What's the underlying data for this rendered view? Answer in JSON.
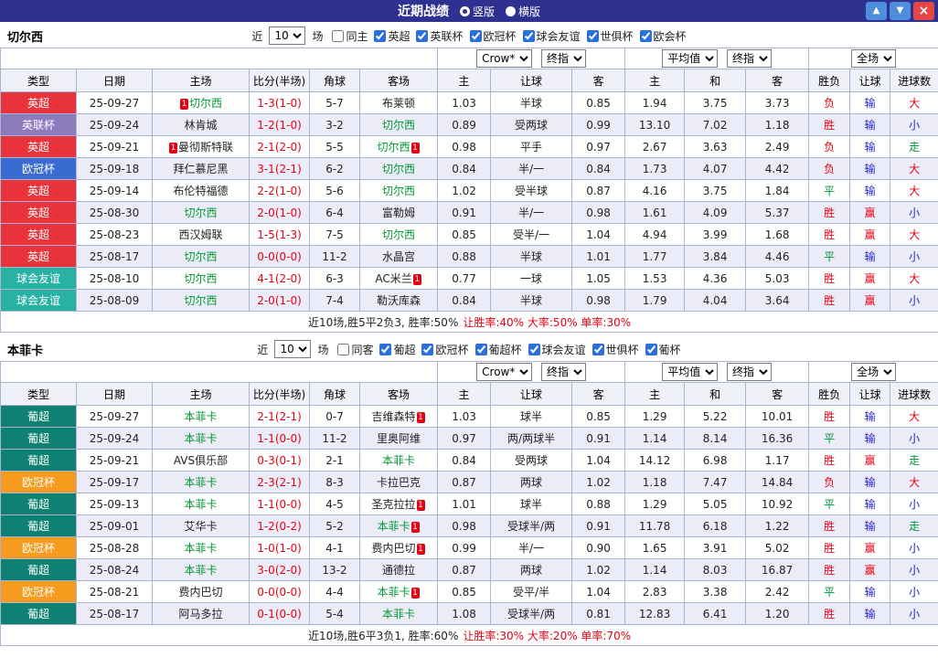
{
  "header": {
    "title": "近期战绩",
    "radios": [
      {
        "label": "竖版",
        "checked": true
      },
      {
        "label": "横版",
        "checked": false
      }
    ],
    "buttons": {
      "up": "▲",
      "down": "▼",
      "close": "×"
    },
    "bar_color": "#2f3190",
    "btn_blue": "#4e8edd",
    "btn_red": "#e64545"
  },
  "palette": {
    "red": "#e60012",
    "blue": "#2525cd",
    "green": "#00943e",
    "focus_green": "#009933"
  },
  "columns": [
    "类型",
    "日期",
    "主场",
    "比分(半场)",
    "角球",
    "客场",
    "主",
    "让球",
    "客",
    "主",
    "和",
    "客",
    "胜负",
    "让球",
    "进球数"
  ],
  "selects_row": {
    "book": "Crow*",
    "final1": "终指",
    "avg": "平均值",
    "final2": "终指",
    "scope": "全场"
  },
  "sections": [
    {
      "team": "切尔西",
      "filter": {
        "prefix": "近",
        "count": "10",
        "suffix": "场",
        "checks": [
          {
            "label": "同主",
            "checked": false
          },
          {
            "label": "英超",
            "checked": true
          },
          {
            "label": "英联杯",
            "checked": true
          },
          {
            "label": "欧冠杯",
            "checked": true
          },
          {
            "label": "球会友谊",
            "checked": true
          },
          {
            "label": "世俱杯",
            "checked": true
          },
          {
            "label": "欧会杯",
            "checked": true
          }
        ]
      },
      "rows": [
        {
          "league": "英超",
          "league_color": "#e8333a",
          "date": "25-09-27",
          "home": {
            "name": "切尔西",
            "focus": true,
            "card_before": "1"
          },
          "score": "1-3(1-0)",
          "corner": "5-7",
          "away": {
            "name": "布莱顿"
          },
          "odds": [
            "1.03",
            "半球",
            "0.85"
          ],
          "euro": [
            "1.94",
            "3.75",
            "3.73"
          ],
          "result": [
            {
              "text": "负",
              "color": "red"
            },
            {
              "text": "输",
              "color": "blue"
            },
            {
              "text": "大",
              "color": "red"
            }
          ]
        },
        {
          "league": "英联杯",
          "league_color": "#8b7cbe",
          "date": "25-09-24",
          "home": {
            "name": "林肯城"
          },
          "score": "1-2(1-0)",
          "corner": "3-2",
          "away": {
            "name": "切尔西",
            "focus": true
          },
          "odds": [
            "0.89",
            "受两球",
            "0.99"
          ],
          "euro": [
            "13.10",
            "7.02",
            "1.18"
          ],
          "result": [
            {
              "text": "胜",
              "color": "red"
            },
            {
              "text": "输",
              "color": "blue"
            },
            {
              "text": "小",
              "color": "blue"
            }
          ]
        },
        {
          "league": "英超",
          "league_color": "#e8333a",
          "date": "25-09-21",
          "home": {
            "name": "曼彻斯特联",
            "card_before": "1"
          },
          "score": "2-1(2-0)",
          "corner": "5-5",
          "away": {
            "name": "切尔西",
            "focus": true,
            "card_after": "1"
          },
          "odds": [
            "0.98",
            "平手",
            "0.97"
          ],
          "euro": [
            "2.67",
            "3.63",
            "2.49"
          ],
          "result": [
            {
              "text": "负",
              "color": "red"
            },
            {
              "text": "输",
              "color": "blue"
            },
            {
              "text": "走",
              "color": "green"
            }
          ]
        },
        {
          "league": "欧冠杯",
          "league_color": "#3a6bd0",
          "date": "25-09-18",
          "home": {
            "name": "拜仁慕尼黑"
          },
          "score": "3-1(2-1)",
          "corner": "6-2",
          "away": {
            "name": "切尔西",
            "focus": true
          },
          "odds": [
            "0.84",
            "半/一",
            "0.84"
          ],
          "euro": [
            "1.73",
            "4.07",
            "4.42"
          ],
          "result": [
            {
              "text": "负",
              "color": "red"
            },
            {
              "text": "输",
              "color": "blue"
            },
            {
              "text": "大",
              "color": "red"
            }
          ]
        },
        {
          "league": "英超",
          "league_color": "#e8333a",
          "date": "25-09-14",
          "home": {
            "name": "布伦特福德"
          },
          "score": "2-2(1-0)",
          "corner": "5-6",
          "away": {
            "name": "切尔西",
            "focus": true
          },
          "odds": [
            "1.02",
            "受半球",
            "0.87"
          ],
          "euro": [
            "4.16",
            "3.75",
            "1.84"
          ],
          "result": [
            {
              "text": "平",
              "color": "green"
            },
            {
              "text": "输",
              "color": "blue"
            },
            {
              "text": "大",
              "color": "red"
            }
          ]
        },
        {
          "league": "英超",
          "league_color": "#e8333a",
          "date": "25-08-30",
          "home": {
            "name": "切尔西",
            "focus": true
          },
          "score": "2-0(1-0)",
          "corner": "6-4",
          "away": {
            "name": "富勒姆"
          },
          "odds": [
            "0.91",
            "半/一",
            "0.98"
          ],
          "euro": [
            "1.61",
            "4.09",
            "5.37"
          ],
          "result": [
            {
              "text": "胜",
              "color": "red"
            },
            {
              "text": "赢",
              "color": "red"
            },
            {
              "text": "小",
              "color": "blue"
            }
          ]
        },
        {
          "league": "英超",
          "league_color": "#e8333a",
          "date": "25-08-23",
          "home": {
            "name": "西汉姆联"
          },
          "score": "1-5(1-3)",
          "corner": "7-5",
          "away": {
            "name": "切尔西",
            "focus": true
          },
          "odds": [
            "0.85",
            "受半/一",
            "1.04"
          ],
          "euro": [
            "4.94",
            "3.99",
            "1.68"
          ],
          "result": [
            {
              "text": "胜",
              "color": "red"
            },
            {
              "text": "赢",
              "color": "red"
            },
            {
              "text": "大",
              "color": "red"
            }
          ]
        },
        {
          "league": "英超",
          "league_color": "#e8333a",
          "date": "25-08-17",
          "home": {
            "name": "切尔西",
            "focus": true
          },
          "score": "0-0(0-0)",
          "corner": "11-2",
          "away": {
            "name": "水晶宫"
          },
          "odds": [
            "0.88",
            "半球",
            "1.01"
          ],
          "euro": [
            "1.77",
            "3.84",
            "4.46"
          ],
          "result": [
            {
              "text": "平",
              "color": "green"
            },
            {
              "text": "输",
              "color": "blue"
            },
            {
              "text": "小",
              "color": "blue"
            }
          ]
        },
        {
          "league": "球会友谊",
          "league_color": "#28b2a2",
          "date": "25-08-10",
          "home": {
            "name": "切尔西",
            "focus": true
          },
          "score": "4-1(2-0)",
          "corner": "6-3",
          "away": {
            "name": "AC米兰",
            "card_after": "1"
          },
          "odds": [
            "0.77",
            "一球",
            "1.05"
          ],
          "euro": [
            "1.53",
            "4.36",
            "5.03"
          ],
          "result": [
            {
              "text": "胜",
              "color": "red"
            },
            {
              "text": "赢",
              "color": "red"
            },
            {
              "text": "大",
              "color": "red"
            }
          ]
        },
        {
          "league": "球会友谊",
          "league_color": "#28b2a2",
          "date": "25-08-09",
          "home": {
            "name": "切尔西",
            "focus": true
          },
          "score": "2-0(1-0)",
          "corner": "7-4",
          "away": {
            "name": "勒沃库森"
          },
          "odds": [
            "0.84",
            "半球",
            "0.98"
          ],
          "euro": [
            "1.79",
            "4.04",
            "3.64"
          ],
          "result": [
            {
              "text": "胜",
              "color": "red"
            },
            {
              "text": "赢",
              "color": "red"
            },
            {
              "text": "小",
              "color": "blue"
            }
          ]
        }
      ],
      "summary": {
        "left": "近10场,胜5平2负3, 胜率:50%",
        "right": "让胜率:40% 大率:50% 单率:30%"
      }
    },
    {
      "team": "本菲卡",
      "filter": {
        "prefix": "近",
        "count": "10",
        "suffix": "场",
        "checks": [
          {
            "label": "同客",
            "checked": false
          },
          {
            "label": "葡超",
            "checked": true
          },
          {
            "label": "欧冠杯",
            "checked": true
          },
          {
            "label": "葡超杯",
            "checked": true
          },
          {
            "label": "球会友谊",
            "checked": true
          },
          {
            "label": "世俱杯",
            "checked": true
          },
          {
            "label": "葡杯",
            "checked": true
          }
        ]
      },
      "rows": [
        {
          "league": "葡超",
          "league_color": "#0e8174",
          "date": "25-09-27",
          "home": {
            "name": "本菲卡",
            "focus": true
          },
          "score": "2-1(2-1)",
          "corner": "0-7",
          "away": {
            "name": "吉维森特",
            "card_after": "1"
          },
          "odds": [
            "1.03",
            "球半",
            "0.85"
          ],
          "euro": [
            "1.29",
            "5.22",
            "10.01"
          ],
          "result": [
            {
              "text": "胜",
              "color": "red"
            },
            {
              "text": "输",
              "color": "blue"
            },
            {
              "text": "大",
              "color": "red"
            }
          ]
        },
        {
          "league": "葡超",
          "league_color": "#0e8174",
          "date": "25-09-24",
          "home": {
            "name": "本菲卡",
            "focus": true
          },
          "score": "1-1(0-0)",
          "corner": "11-2",
          "away": {
            "name": "里奥阿维"
          },
          "odds": [
            "0.97",
            "两/两球半",
            "0.91"
          ],
          "euro": [
            "1.14",
            "8.14",
            "16.36"
          ],
          "result": [
            {
              "text": "平",
              "color": "green"
            },
            {
              "text": "输",
              "color": "blue"
            },
            {
              "text": "小",
              "color": "blue"
            }
          ]
        },
        {
          "league": "葡超",
          "league_color": "#0e8174",
          "date": "25-09-21",
          "home": {
            "name": "AVS俱乐部"
          },
          "score": "0-3(0-1)",
          "corner": "2-1",
          "away": {
            "name": "本菲卡",
            "focus": true
          },
          "odds": [
            "0.84",
            "受两球",
            "1.04"
          ],
          "euro": [
            "14.12",
            "6.98",
            "1.17"
          ],
          "result": [
            {
              "text": "胜",
              "color": "red"
            },
            {
              "text": "赢",
              "color": "red"
            },
            {
              "text": "走",
              "color": "green"
            }
          ]
        },
        {
          "league": "欧冠杯",
          "league_color": "#f79b1e",
          "date": "25-09-17",
          "home": {
            "name": "本菲卡",
            "focus": true
          },
          "score": "2-3(2-1)",
          "corner": "8-3",
          "away": {
            "name": "卡拉巴克"
          },
          "odds": [
            "0.87",
            "两球",
            "1.02"
          ],
          "euro": [
            "1.18",
            "7.47",
            "14.84"
          ],
          "result": [
            {
              "text": "负",
              "color": "red"
            },
            {
              "text": "输",
              "color": "blue"
            },
            {
              "text": "大",
              "color": "red"
            }
          ]
        },
        {
          "league": "葡超",
          "league_color": "#0e8174",
          "date": "25-09-13",
          "home": {
            "name": "本菲卡",
            "focus": true
          },
          "score": "1-1(0-0)",
          "corner": "4-5",
          "away": {
            "name": "圣克拉拉",
            "card_after": "1"
          },
          "odds": [
            "1.01",
            "球半",
            "0.88"
          ],
          "euro": [
            "1.29",
            "5.05",
            "10.92"
          ],
          "result": [
            {
              "text": "平",
              "color": "green"
            },
            {
              "text": "输",
              "color": "blue"
            },
            {
              "text": "小",
              "color": "blue"
            }
          ]
        },
        {
          "league": "葡超",
          "league_color": "#0e8174",
          "date": "25-09-01",
          "home": {
            "name": "艾华卡"
          },
          "score": "1-2(0-2)",
          "corner": "5-2",
          "away": {
            "name": "本菲卡",
            "focus": true,
            "card_after": "1"
          },
          "odds": [
            "0.98",
            "受球半/两",
            "0.91"
          ],
          "euro": [
            "11.78",
            "6.18",
            "1.22"
          ],
          "result": [
            {
              "text": "胜",
              "color": "red"
            },
            {
              "text": "输",
              "color": "blue"
            },
            {
              "text": "走",
              "color": "green"
            }
          ]
        },
        {
          "league": "欧冠杯",
          "league_color": "#f79b1e",
          "date": "25-08-28",
          "home": {
            "name": "本菲卡",
            "focus": true
          },
          "score": "1-0(1-0)",
          "corner": "4-1",
          "away": {
            "name": "费内巴切",
            "card_after": "1"
          },
          "odds": [
            "0.99",
            "半/一",
            "0.90"
          ],
          "euro": [
            "1.65",
            "3.91",
            "5.02"
          ],
          "result": [
            {
              "text": "胜",
              "color": "red"
            },
            {
              "text": "赢",
              "color": "red"
            },
            {
              "text": "小",
              "color": "blue"
            }
          ]
        },
        {
          "league": "葡超",
          "league_color": "#0e8174",
          "date": "25-08-24",
          "home": {
            "name": "本菲卡",
            "focus": true
          },
          "score": "3-0(2-0)",
          "corner": "13-2",
          "away": {
            "name": "通德拉"
          },
          "odds": [
            "0.87",
            "两球",
            "1.02"
          ],
          "euro": [
            "1.14",
            "8.03",
            "16.87"
          ],
          "result": [
            {
              "text": "胜",
              "color": "red"
            },
            {
              "text": "赢",
              "color": "red"
            },
            {
              "text": "小",
              "color": "blue"
            }
          ]
        },
        {
          "league": "欧冠杯",
          "league_color": "#f79b1e",
          "date": "25-08-21",
          "home": {
            "name": "费内巴切"
          },
          "score": "0-0(0-0)",
          "corner": "4-4",
          "away": {
            "name": "本菲卡",
            "focus": true,
            "card_after": "1"
          },
          "odds": [
            "0.85",
            "受平/半",
            "1.04"
          ],
          "euro": [
            "2.83",
            "3.38",
            "2.42"
          ],
          "result": [
            {
              "text": "平",
              "color": "green"
            },
            {
              "text": "输",
              "color": "blue"
            },
            {
              "text": "小",
              "color": "blue"
            }
          ]
        },
        {
          "league": "葡超",
          "league_color": "#0e8174",
          "date": "25-08-17",
          "home": {
            "name": "阿马多拉"
          },
          "score": "0-1(0-0)",
          "corner": "5-4",
          "away": {
            "name": "本菲卡",
            "focus": true
          },
          "odds": [
            "1.08",
            "受球半/两",
            "0.81"
          ],
          "euro": [
            "12.83",
            "6.41",
            "1.20"
          ],
          "result": [
            {
              "text": "胜",
              "color": "red"
            },
            {
              "text": "输",
              "color": "blue"
            },
            {
              "text": "小",
              "color": "blue"
            }
          ]
        }
      ],
      "summary": {
        "left": "近10场,胜6平3负1, 胜率:60%",
        "right": "让胜率:30% 大率:20% 单率:70%"
      }
    }
  ]
}
